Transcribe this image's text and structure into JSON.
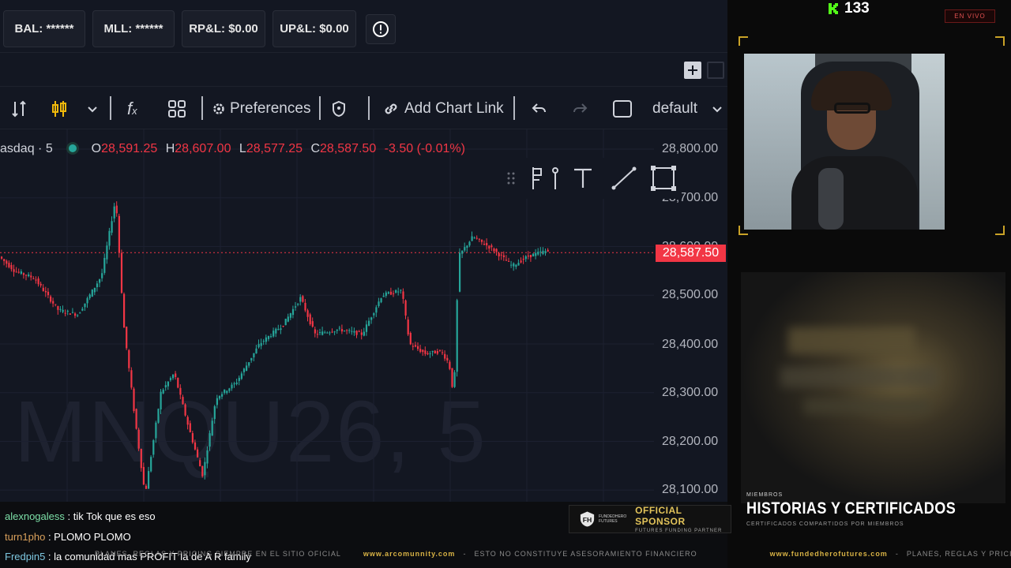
{
  "account": {
    "bal": "BAL: ******",
    "mll": "MLL: ******",
    "rpl": "RP&L: $0.00",
    "upl": "UP&L: $0.00"
  },
  "toolbar": {
    "preferences": "Preferences",
    "add_chart_link": "Add Chart Link",
    "layout": "default"
  },
  "chart": {
    "symbol": "asdaq · 5",
    "open_label": "O",
    "open": "28,591.25",
    "high_label": "H",
    "high": "28,607.00",
    "low_label": "L",
    "low": "28,577.25",
    "close_label": "C",
    "close": "28,587.50",
    "change": "-3.50 (-0.01%)",
    "watermark": "MNQU26, 5",
    "last_price": "28,587.50",
    "price_levels": [
      "28,800.00",
      "28,700.00",
      "28,600.00",
      "28,500.00",
      "28,400.00",
      "28,300.00",
      "28,200.00",
      "28,100.00"
    ],
    "up_color": "#26a69a",
    "down_color": "#f23645"
  },
  "chart_data": {
    "type": "candlestick",
    "y_axis_ticks": [
      28800,
      28700,
      28600,
      28500,
      28400,
      28300,
      28200,
      28100
    ],
    "last_close": 28587.5
  },
  "stream": {
    "viewers": "133",
    "live": "EN VIVO",
    "section_small": "MIEMBROS",
    "section_title": "HISTORIAS Y CERTIFICADOS",
    "section_sub": "CERTIFICADOS COMPARTIDOS POR MIEMBROS",
    "sponsor_title": "OFFICIAL SPONSOR",
    "sponsor_sub": "FUTURES FUNDING PARTNER",
    "sponsor_logo": "FUNDEDHERO FUTURES"
  },
  "chat": [
    {
      "user": "alexnogaless",
      "msg": " : tik Tok que es eso"
    },
    {
      "user": "turn1pho",
      "msg": " : PLOMO PLOMO"
    },
    {
      "user": "Fredpin5",
      "msg": " : la comunidad mas PROFIT la de A R family"
    }
  ],
  "ticker": {
    "left": "PLANES, REGLAS Y PRICING SIEMPRE EN EL SITIO OFICIAL",
    "site1": "www.arcomunnity.com",
    "disclaimer": "ESTO NO CONSTITUYE ASESORAMIENTO FINANCIERO",
    "site2": "www.fundedherofutures.com",
    "right": "PLANES, REGLAS Y PRICING"
  }
}
